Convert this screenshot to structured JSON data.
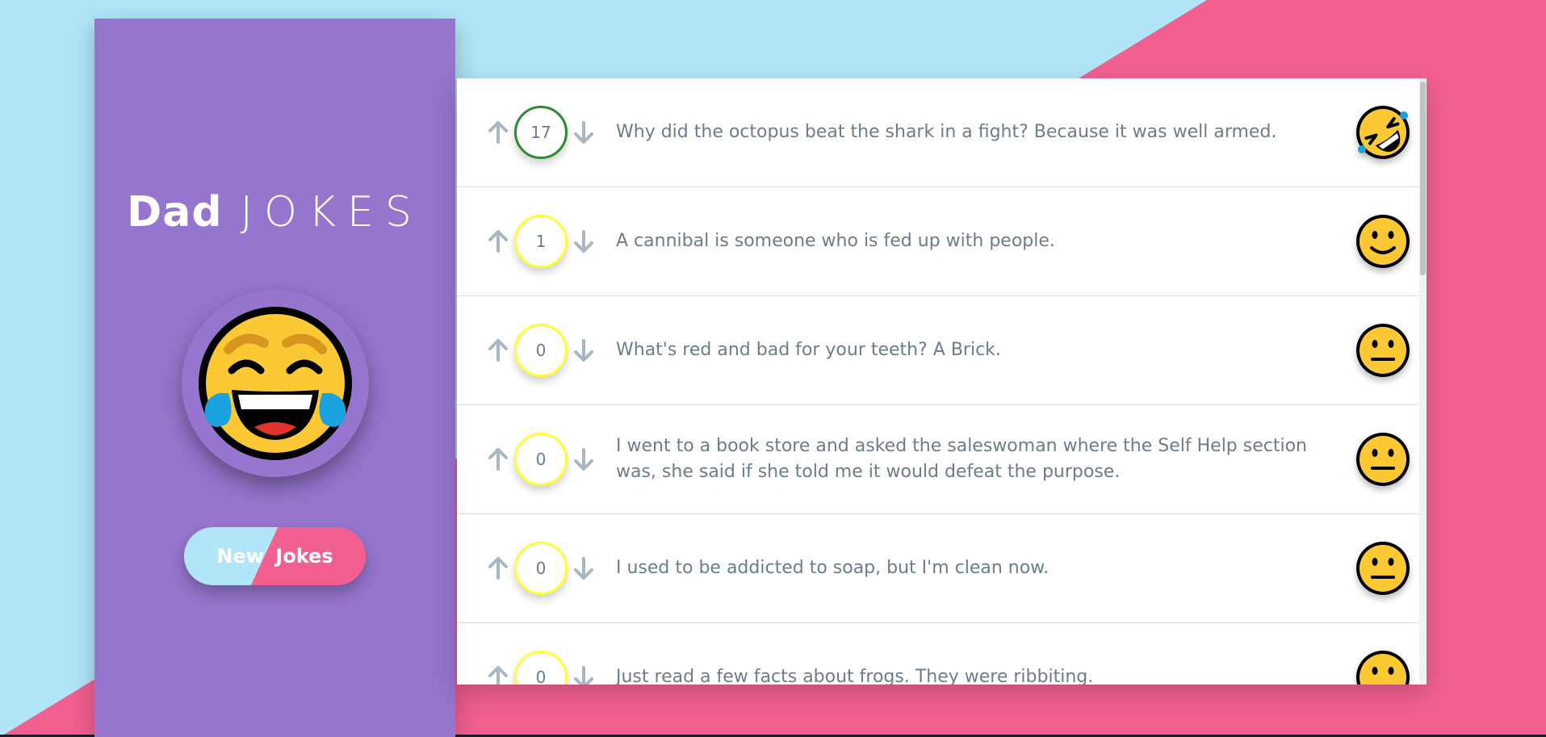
{
  "app": {
    "title_bold": "Dad",
    "title_light": "JOKES",
    "hero_emoji": "laughing-crying-face",
    "new_jokes_label": "New Jokes"
  },
  "colors": {
    "background_light": "#b1e6f9",
    "background_pink": "#f26090",
    "sidebar": "#9575cd",
    "score_high": "#2e8b2e",
    "score_low": "#ffff33",
    "text": "#6b7d8c"
  },
  "jokes": [
    {
      "votes": "17",
      "text": "Why did the octopus beat the shark in a fight? Because it was well armed.",
      "emoji": "rolling-on-floor-laughing",
      "level": "high"
    },
    {
      "votes": "1",
      "text": "A cannibal is someone who is fed up with people.",
      "emoji": "slightly-smiling",
      "level": "low"
    },
    {
      "votes": "0",
      "text": "What's red and bad for your teeth? A Brick.",
      "emoji": "neutral",
      "level": "low"
    },
    {
      "votes": "0",
      "text": "I went to a book store and asked the saleswoman where the Self Help section was, she said if she told me it would defeat the purpose.",
      "emoji": "neutral",
      "level": "low"
    },
    {
      "votes": "0",
      "text": "I used to be addicted to soap, but I'm clean now.",
      "emoji": "neutral",
      "level": "low"
    },
    {
      "votes": "0",
      "text": "Just read a few facts about frogs. They were ribbiting.",
      "emoji": "neutral",
      "level": "low"
    }
  ]
}
